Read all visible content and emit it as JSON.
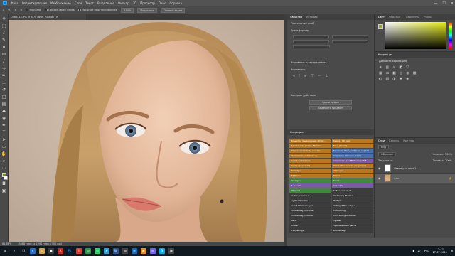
{
  "menu": {
    "items": [
      "Файл",
      "Редактирование",
      "Изображение",
      "Слои",
      "Текст",
      "Выделение",
      "Фильтр",
      "3D",
      "Просмотр",
      "Окно",
      "Справка"
    ]
  },
  "window_controls": {
    "minimize": "—",
    "maximize": "☐",
    "close": "✕"
  },
  "options_bar": {
    "sample_all_layers": "Образец всех слоев",
    "zoom_label": "Масштаб",
    "scrubby": "Масштаб перетаскиванием",
    "zoom_value": "100%",
    "fit_button": "Подогнать",
    "fill_button": "Полный экран"
  },
  "document": {
    "tab_title": "Olia4413.JPG @ 61% (Фон, RGB/8)",
    "close": "✕"
  },
  "status": {
    "zoom": "61.86%",
    "doc_info": "3888 пикс. x 2592 пикс. (300 ppi)"
  },
  "properties_panel": {
    "tabs": [
      "Свойства",
      "История"
    ],
    "layer_kind": "Пиксельный слой",
    "transform_title": "Трансформир.",
    "align_title": "Выровнять и распределить",
    "align_sub": "Выровнять:",
    "quick_actions_title": "Быстрые действия",
    "remove_bg": "Удалить фон",
    "select_subject": "Выделить предмет"
  },
  "actions_panel": {
    "title": "Операции",
    "buttons": [
      {
        "label": "Виньетка (выделенная облас...",
        "color": "#b9781e"
      },
      {
        "label": "Рамка - 50 пикс.",
        "color": "#b9781e"
      },
      {
        "label": "Деревянная рама - 50 пикс.",
        "color": "#b9781e"
      },
      {
        "label": "Тень (текст)",
        "color": "#b9781e"
      },
      {
        "label": "Отражение в воде (текст)",
        "color": "#b9781e"
      },
      {
        "label": "Заказной RGB в оттенки серого",
        "color": "#4a6fb0"
      },
      {
        "label": "Расплавленный свинец",
        "color": "#b9781e"
      },
      {
        "label": "Создание клиньев (слой)",
        "color": "#4a6fb0"
      },
      {
        "label": "Цвета видеоряда",
        "color": "#b9781e"
      },
      {
        "label": "Сохранить как Photoshop PDF",
        "color": "#7a5aa8"
      },
      {
        "label": "Карта градиента",
        "color": "#b9781e"
      },
      {
        "label": "Настройки краски-полутонов...",
        "color": "#b9781e"
      },
      {
        "label": "Фильтры",
        "color": "#b9781e"
      },
      {
        "label": "Оттенки",
        "color": "#b9781e"
      },
      {
        "label": "Эффекты",
        "color": "#b9781e"
      },
      {
        "label": "Рамки",
        "color": "#b9781e"
      },
      {
        "label": "Текстуры",
        "color": "#3f8a3a"
      },
      {
        "label": "Текст",
        "color": "#3f8a3a"
      },
      {
        "label": "Вырезать",
        "color": "#7a5aa8"
      },
      {
        "label": "Смешать",
        "color": "#7a5aa8"
      },
      {
        "label": "Обрезка",
        "color": "#3f8a3a"
      },
      {
        "label": "Soften screen +1",
        "color": "#3c3c3c"
      },
      {
        "label": "Soften screen +2",
        "color": "#3c3c3c"
      },
      {
        "label": "Darkening Shadow",
        "color": "#3c3c3c"
      },
      {
        "label": "Lighten Shadow",
        "color": "#3c3c3c"
      },
      {
        "label": "Multiply",
        "color": "#3c3c3c"
      },
      {
        "label": "Select Masked Layer",
        "color": "#3c3c3c"
      },
      {
        "label": "Highlight the Subject",
        "color": "#3c3c3c"
      },
      {
        "label": "Contrasting Mid-Tone",
        "color": "#3c3c3c"
      },
      {
        "label": "Cool Toning",
        "color": "#3c3c3c"
      },
      {
        "label": "Contrasting midtone",
        "color": "#3c3c3c"
      },
      {
        "label": "Contrasting Midtones",
        "color": "#3c3c3c"
      },
      {
        "label": "Кабо",
        "color": "#3c3c3c"
      },
      {
        "label": "Лунная",
        "color": "#3c3c3c"
      },
      {
        "label": "Осень",
        "color": "#3c3c3c"
      },
      {
        "label": "Пригашенные цвета",
        "color": "#3c3c3c"
      },
      {
        "label": "sharpening1",
        "color": "#3c3c3c"
      },
      {
        "label": "sharpening2",
        "color": "#3c3c3c"
      }
    ]
  },
  "color_panel": {
    "tabs": [
      "Цвет",
      "Образцы",
      "Градиенты",
      "Узоры"
    ],
    "active_color": "#9aa52a"
  },
  "adjustments_panel": {
    "tabs": [
      "Коррекция"
    ],
    "add_label": "Добавить коррекцию"
  },
  "layers_panel": {
    "tabs": [
      "Слои",
      "Каналы",
      "Контуры"
    ],
    "kind_label": "Вид",
    "mode_label": "Обычные",
    "opacity_label": "Непрозр.: 100%",
    "lock_label": "Закрепить:",
    "fill_label": "Заливка: 100%",
    "layers": [
      {
        "name": "Левое ухо слоя 1",
        "selected": false
      },
      {
        "name": "Фон",
        "selected": true
      }
    ]
  },
  "taskbar": {
    "time": "13:47",
    "date": "27.07.2020",
    "lang": "РУС"
  }
}
